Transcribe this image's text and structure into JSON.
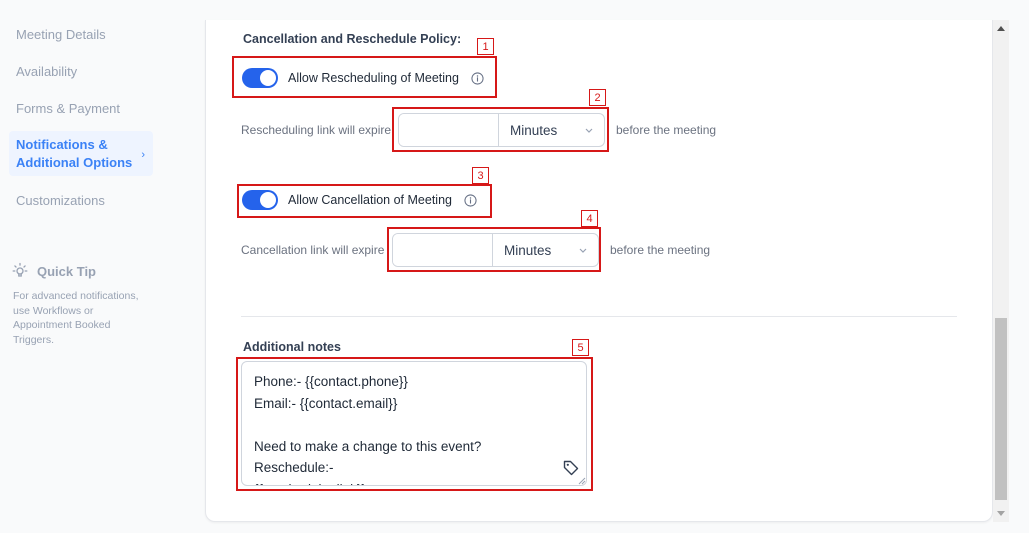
{
  "sidebar": {
    "items": [
      {
        "label": "Meeting Details"
      },
      {
        "label": "Availability"
      },
      {
        "label": "Forms & Payment"
      },
      {
        "label": "Notifications &\nAdditional Options",
        "active": true
      },
      {
        "label": "Customizations"
      }
    ],
    "quick_tip": {
      "title": "Quick Tip",
      "text": "For advanced notifications, use Workflows or Appointment Booked Triggers."
    }
  },
  "policy": {
    "heading": "Cancellation and Reschedule Policy:",
    "reschedule": {
      "toggle_label": "Allow Rescheduling of Meeting",
      "enabled": true,
      "expire_label": "Rescheduling link will expire",
      "value": "",
      "unit": "Minutes",
      "suffix": "before the meeting"
    },
    "cancellation": {
      "toggle_label": "Allow Cancellation of Meeting",
      "enabled": true,
      "expire_label": "Cancellation link will expire",
      "value": "",
      "unit": "Minutes",
      "suffix": "before the meeting"
    }
  },
  "notes": {
    "heading": "Additional notes",
    "value": "Phone:- {{contact.phone}}\nEmail:- {{contact.email}}\n\nNeed to make a change to this event?\nReschedule:-\n{{reschedule_link}}"
  },
  "annotations": [
    "1",
    "2",
    "3",
    "4",
    "5"
  ],
  "colors": {
    "accent": "#2563eb",
    "active_nav_bg": "#eef4ff",
    "annotation": "#d61818"
  }
}
